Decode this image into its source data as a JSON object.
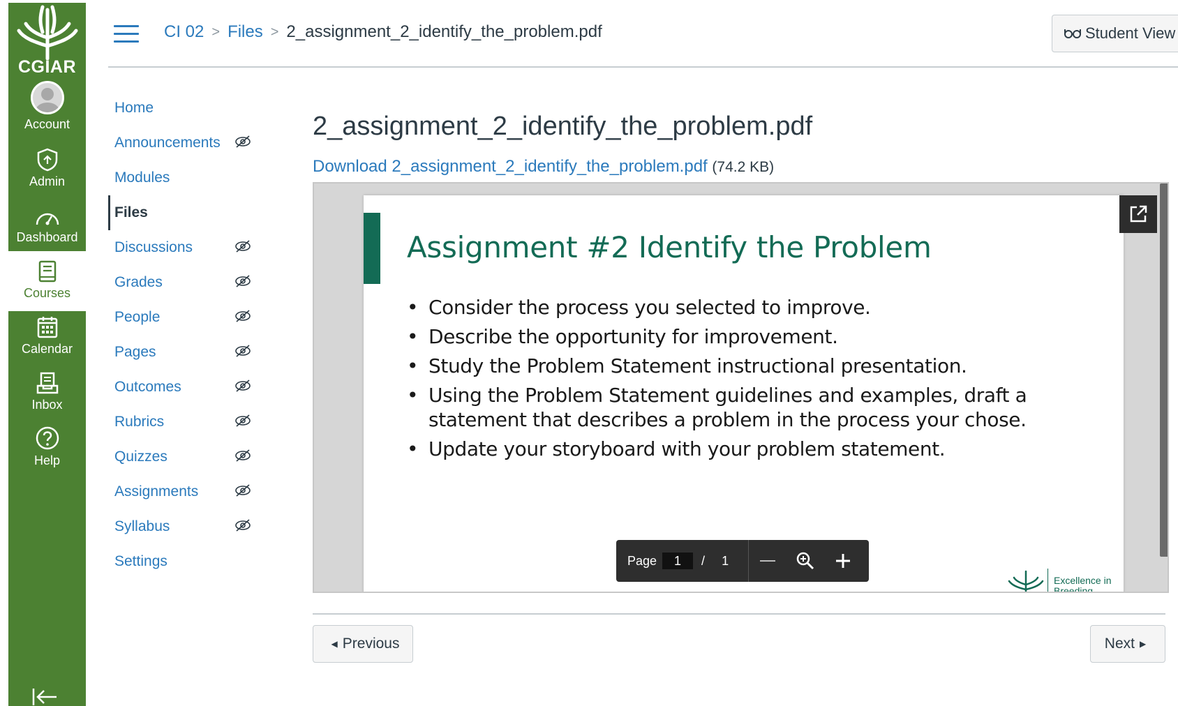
{
  "brand": {
    "name": "CGIAR",
    "color": "#4c8132"
  },
  "global_nav": [
    {
      "label": "Account",
      "icon": "account-avatar-icon"
    },
    {
      "label": "Admin",
      "icon": "admin-shield-icon"
    },
    {
      "label": "Dashboard",
      "icon": "dashboard-icon"
    },
    {
      "label": "Courses",
      "icon": "courses-book-icon",
      "active": true
    },
    {
      "label": "Calendar",
      "icon": "calendar-icon"
    },
    {
      "label": "Inbox",
      "icon": "inbox-icon"
    },
    {
      "label": "Help",
      "icon": "help-icon"
    }
  ],
  "breadcrumb": {
    "course": "CI 02",
    "section": "Files",
    "current": "2_assignment_2_identify_the_problem.pdf",
    "separator": ">"
  },
  "header": {
    "student_view_label": "Student View"
  },
  "course_nav": [
    {
      "label": "Home",
      "hidden": false
    },
    {
      "label": "Announcements",
      "hidden": true
    },
    {
      "label": "Modules",
      "hidden": false
    },
    {
      "label": "Files",
      "hidden": false,
      "active": true
    },
    {
      "label": "Discussions",
      "hidden": true
    },
    {
      "label": "Grades",
      "hidden": true
    },
    {
      "label": "People",
      "hidden": true
    },
    {
      "label": "Pages",
      "hidden": true
    },
    {
      "label": "Outcomes",
      "hidden": true
    },
    {
      "label": "Rubrics",
      "hidden": true
    },
    {
      "label": "Quizzes",
      "hidden": true
    },
    {
      "label": "Assignments",
      "hidden": true
    },
    {
      "label": "Syllabus",
      "hidden": true
    },
    {
      "label": "Settings",
      "hidden": false
    }
  ],
  "file": {
    "title": "2_assignment_2_identify_the_problem.pdf",
    "download_label": "Download 2_assignment_2_identify_the_problem.pdf",
    "size": "(74.2 KB)"
  },
  "slide": {
    "title": "Assignment #2 Identify the Problem",
    "bullets": [
      "Consider the process you selected to improve.",
      "Describe the opportunity for improvement.",
      "Study the Problem Statement instructional presentation.",
      "Using the Problem Statement guidelines and examples, draft a statement that describes a problem in the process your chose.",
      "Update your storyboard with your problem statement."
    ],
    "logo_text_1": "Excellence in",
    "logo_text_2": "Breeding",
    "accent_color": "#136b55"
  },
  "pager": {
    "page_label": "Page",
    "current_page": "1",
    "slash": "/",
    "total_pages": "1"
  },
  "footer": {
    "previous_label": "Previous",
    "next_label": "Next"
  }
}
